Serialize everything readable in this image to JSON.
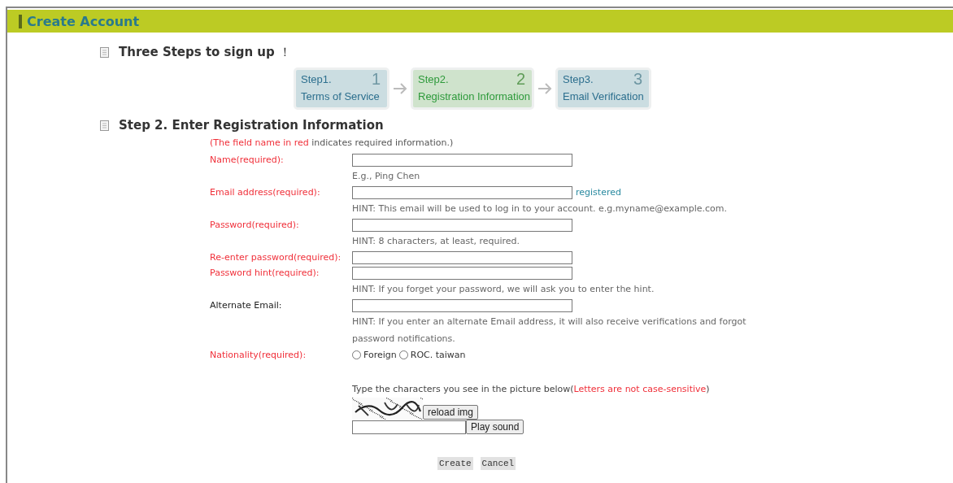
{
  "header": {
    "title": "Create Account"
  },
  "intro": {
    "heading": "**Three Steps to sign up** ！"
  },
  "steps": [
    {
      "label": "Step1.",
      "name": "Terms of Service",
      "numeral": "1",
      "selected": false
    },
    {
      "label": "Step2.",
      "name": "Registration Information",
      "numeral": "2",
      "selected": true
    },
    {
      "label": "Step3.",
      "name": "Email Verification",
      "numeral": "3",
      "selected": false
    }
  ],
  "form": {
    "heading": "Step 2. Enter Registration Information",
    "note": {
      "highlight": "(The field name in red",
      "rest": " indicates required information.)"
    },
    "fields": [
      {
        "label": "Name(required):",
        "required": true,
        "hint": "E.g., Ping Chen"
      },
      {
        "label": "Email address(required):",
        "required": true,
        "status": "registered",
        "hint": "HINT: This email will be used to log in to your account. e.g.myname@example.com."
      },
      {
        "label": "Password(required):",
        "required": true,
        "hint": "HINT: 8 characters, at least, required."
      },
      {
        "label": "Re-enter password(required):",
        "required": true
      },
      {
        "label": "Password hint(required):",
        "required": true,
        "hint": "HINT: If you forget your password, we will ask you to enter the hint."
      },
      {
        "label": "Alternate Email:",
        "required": false,
        "hint": "HINT: If you enter an alternate Email address, it will also receive verifications and forgot password notifications."
      }
    ],
    "nationality": {
      "label": "Nationality(required):",
      "required": true,
      "options": [
        {
          "label": "Foreign",
          "selected": false
        },
        {
          "label": "ROC. taiwan",
          "selected": false
        }
      ]
    },
    "captcha": {
      "instruction": "Type the characters you see in the picture below(",
      "note": "Letters are not case-sensitive",
      "closing": ")",
      "reload_button": "reload img",
      "sound_button": "Play sound"
    }
  },
  "buttons": [
    "Create",
    "Cancel"
  ]
}
